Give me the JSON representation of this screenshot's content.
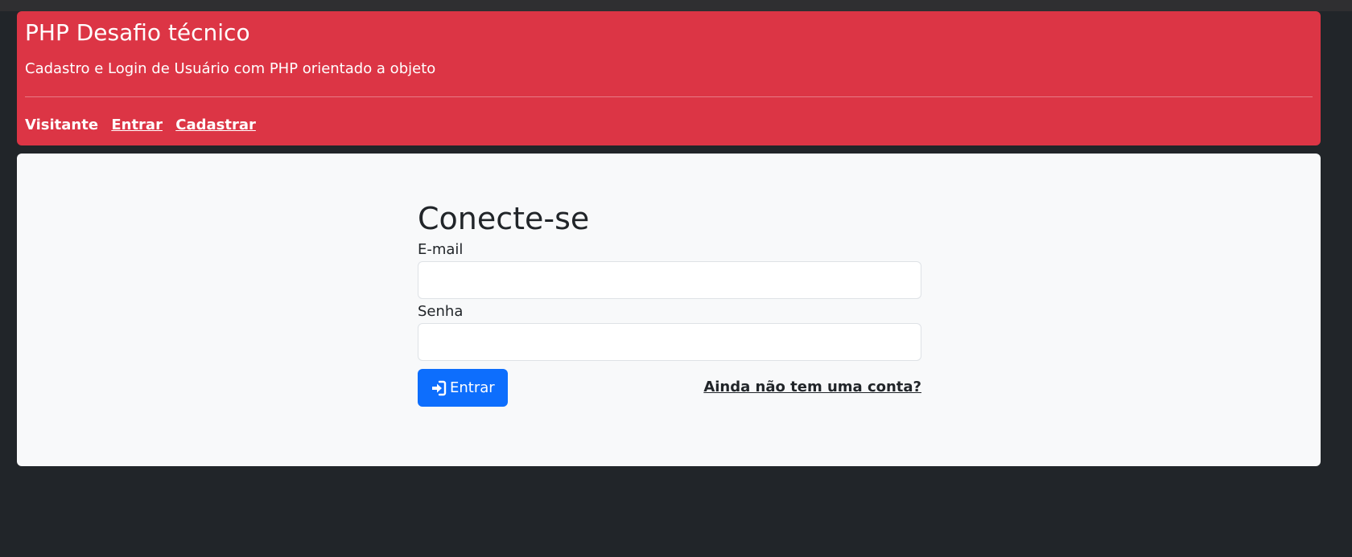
{
  "header": {
    "title": "PHP Desafio técnico",
    "subtitle": "Cadastro e Login de Usuário com PHP orientado a objeto",
    "nav": {
      "visitor_label": "Visitante",
      "login_link": "Entrar",
      "register_link": "Cadastrar"
    },
    "background_color": "#dc3545"
  },
  "login_form": {
    "title": "Conecte-se",
    "email_label": "E-mail",
    "email_value": "",
    "password_label": "Senha",
    "password_value": "",
    "submit_label": "Entrar",
    "submit_icon": "sign-in-icon",
    "submit_color": "#0d6efd",
    "register_prompt": "Ainda não tem uma conta?"
  },
  "theme": {
    "page_background": "#212529",
    "card_background": "#f8f9fa"
  }
}
